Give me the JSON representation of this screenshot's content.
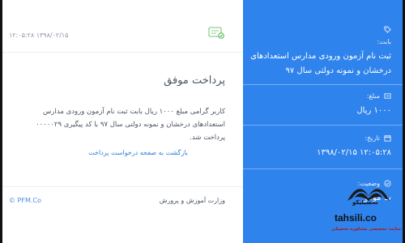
{
  "card": {
    "timestamp": "۱۲:۰۵:۲۸ ۱۳۹۸/۰۲/۱۵",
    "title": "پرداخت موفق",
    "message": "کاربر گرامی مبلغ ۱۰۰۰ ریال بابت ثبت نام آزمون ورودی مدارس استعدادهای درخشان و نمونه دولتی سال ۹۷ با کد پیگیری ۰۰۰۰۰۲۹ پرداخت شد.",
    "back_link": "بازگشت به صفحه درخواست پرداخت",
    "brand": "© PFM.Co",
    "ministry": "وزارت آموزش و پرورش"
  },
  "sidebar": {
    "purpose_label": "بابت:",
    "purpose_value": "ثبت نام آزمون ورودی مدارس استعدادهای درخشان و نمونه دولتی سال ۹۷",
    "amount_label": "مبلغ:",
    "amount_value": "۱۰۰۰ ریال",
    "date_label": "تاریخ:",
    "date_value": "۱۲:۰۵:۲۸ ۱۳۹۸/۰۲/۱۵",
    "status_label": "وضعیت:",
    "status_value": "ت موفق"
  },
  "watermark": {
    "line1": "تحصیلیکو",
    "line2": "tahsili.co",
    "line3": "سایت تخصصی مشاوره تحصیلی"
  },
  "colors": {
    "sidebar": "#2f83ec",
    "link": "#2f7fd9",
    "text": "#4a5563"
  }
}
